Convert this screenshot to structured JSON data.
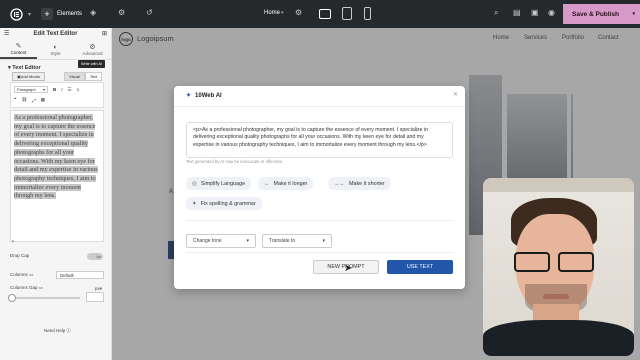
{
  "topbar": {
    "elements_label": "Elements",
    "page_label": "Home",
    "save_label": "Save & Publish"
  },
  "left_panel": {
    "title": "Edit Text Editor",
    "tabs": [
      {
        "label": "Content",
        "icon": "pencil-icon"
      },
      {
        "label": "Style",
        "icon": "half-circle-icon"
      },
      {
        "label": "Advanced",
        "icon": "gear-icon"
      }
    ],
    "section_title": "Text Editor",
    "write_ai_label": "Write with AI",
    "add_media_label": "Add Media",
    "visual_tab": "Visual",
    "text_tab": "Text",
    "paragraph_select": "Paragraph",
    "editor_text": "As a professional photographer, my goal is to capture the essence of every moment. I specialize in delivering exceptional quality photographs for all your occasions. With my keen eye for detail and my expertise in various photography techniques, I aim to immortalize every moment through my lens.",
    "path_label": "p",
    "drop_cap_label": "Drop Cap",
    "drop_cap_value": "No",
    "columns_label": "Columns",
    "columns_value": "Default",
    "columns_gap_label": "Columns Gap",
    "columns_gap_unit": "px",
    "need_help": "Need Help"
  },
  "site": {
    "logo_badge": "logo",
    "logo_text": "Logoipsum",
    "nav": [
      "Home",
      "Services",
      "Portfolio",
      "Contact"
    ],
    "heading_fragment": "A"
  },
  "modal": {
    "title": "10Web AI",
    "generated_text": "<p>As a professional photographer, my goal is to capture the essence of every moment. I specialize in delivering exceptional quality photographs for all your occasions. With my keen eye for detail and my expertise in various photography techniques, I aim to immortalize every moment through my lens.</p>",
    "note": "Text generated by AI may be inaccurate or offensive",
    "chips": [
      {
        "label": "Simplify Language",
        "icon": "simplify-icon"
      },
      {
        "label": "Make it longer",
        "icon": "expand-icon"
      },
      {
        "label": "Make it shorter",
        "icon": "shrink-icon"
      },
      {
        "label": "Fix spelling & grammar",
        "icon": "sparkle-icon"
      }
    ],
    "change_tone": "Change tone",
    "translate_to": "Translate to",
    "new_prompt": "NEW PROMPT",
    "use_text": "USE TEXT"
  },
  "colors": {
    "topbar_bg": "#26292c",
    "save_button": "#d699c8",
    "primary_blue": "#2156a8"
  }
}
